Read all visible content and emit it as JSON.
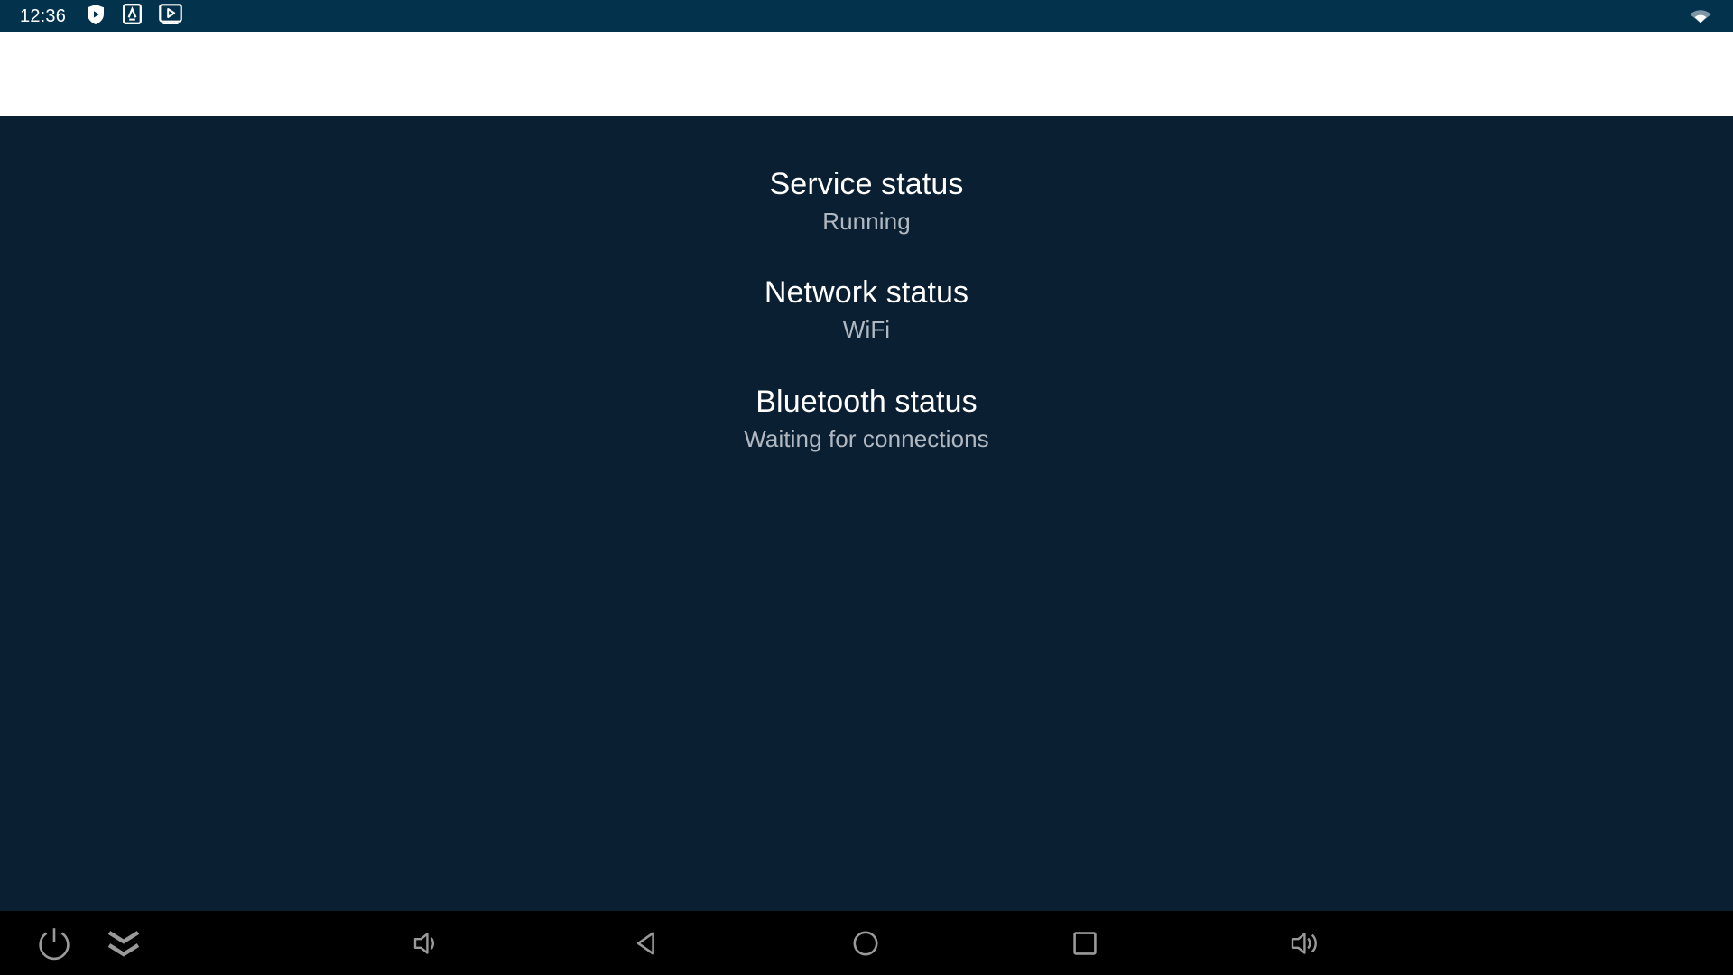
{
  "status_bar": {
    "clock": "12:36",
    "background_color": "#03324d",
    "left_icons": [
      {
        "name": "shield-play-icon",
        "label": "Protected playback"
      },
      {
        "name": "letter-a-badge-icon",
        "label": "A"
      },
      {
        "name": "video-player-badge-icon",
        "label": "Media player"
      }
    ],
    "right_icons": [
      {
        "name": "wifi-icon",
        "label": "WiFi connected"
      }
    ]
  },
  "top_band": {
    "background_color": "#ffffff"
  },
  "content": {
    "background_color": "#0b1f33",
    "title_color": "#ffffff",
    "value_color": "#b0b9c2",
    "blocks": [
      {
        "title": "Service status",
        "value": "Running"
      },
      {
        "title": "Network status",
        "value": "WiFi"
      },
      {
        "title": "Bluetooth status",
        "value": "Waiting for connections"
      }
    ]
  },
  "nav_bar": {
    "background_color": "#000000",
    "icon_color": "#9a9a9a",
    "buttons": [
      {
        "name": "power-button",
        "label": "Power"
      },
      {
        "name": "collapse-button",
        "label": "Collapse"
      },
      {
        "name": "volume-down-button",
        "label": "Volume down"
      },
      {
        "name": "back-button",
        "label": "Back"
      },
      {
        "name": "home-button",
        "label": "Home"
      },
      {
        "name": "recents-button",
        "label": "Recents"
      },
      {
        "name": "volume-up-button",
        "label": "Volume up"
      }
    ]
  }
}
